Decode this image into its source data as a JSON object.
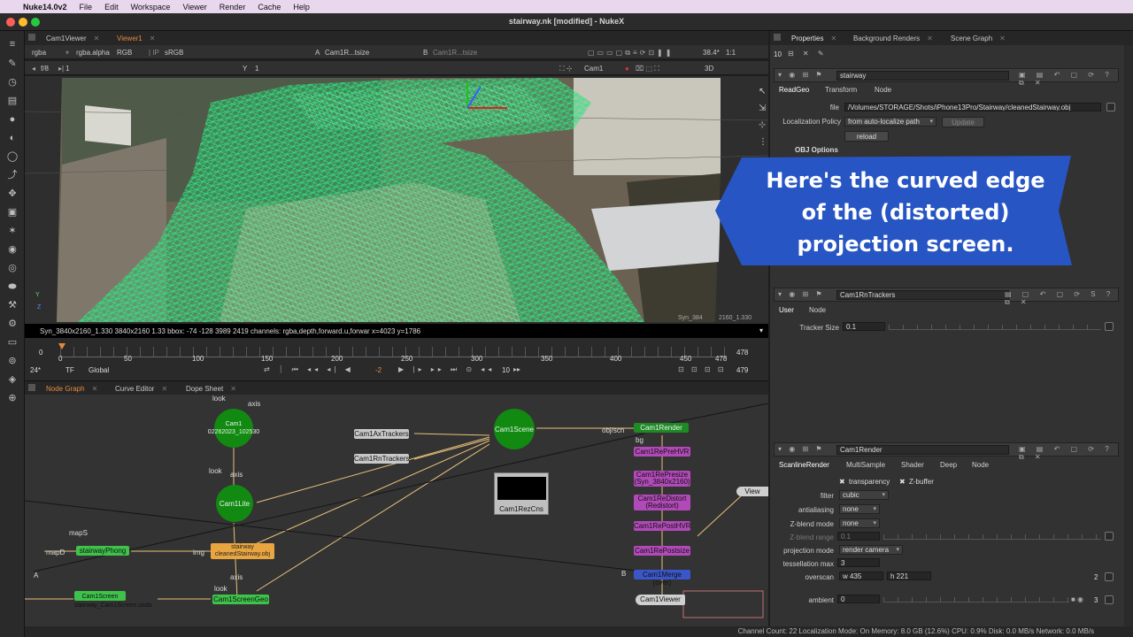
{
  "menubar": {
    "app": "Nuke14.0v2",
    "items": [
      "File",
      "Edit",
      "Workspace",
      "Viewer",
      "Render",
      "Cache",
      "Help"
    ]
  },
  "window": {
    "title": "stairway.nk [modified] - NukeX"
  },
  "viewer": {
    "tabs": [
      "Cam1Viewer",
      "Viewer1"
    ],
    "bar1": {
      "channels": "rgba",
      "alpha": "rgba.alpha",
      "colorspace": "RGB",
      "lut": "sRGB",
      "input_a_label": "A",
      "input_a": "Cam1R...tsize",
      "input_b_label": "B",
      "input_b": "Cam1R...tsize",
      "zoom": "38.4*",
      "ratio": "1:1"
    },
    "bar2": {
      "fstop": "f/8",
      "frame": "1",
      "y_label": "Y",
      "y_value": "1",
      "camera": "Cam1",
      "view_mode": "3D"
    },
    "overlay_corner": "Syn_384",
    "overlay_corner2": "2160_1.330",
    "axis_y": "Y",
    "axis_z": "Z",
    "info": "Syn_3840x2160_1.330 3840x2160 1.33  bbox: -74 -128 3989 2419 channels: rgba,depth,forward.u,forwar  x=4023 y=1786"
  },
  "timeline": {
    "ticks": [
      "0",
      "50",
      "100",
      "150",
      "200",
      "250",
      "300",
      "350",
      "400",
      "450",
      "478"
    ],
    "start": "0",
    "end_top": "478",
    "end_bottom": "479",
    "fps": "24*",
    "tf": "TF",
    "mode": "Global",
    "step_back": "-2",
    "step": "10"
  },
  "nodegraph": {
    "tabs": [
      "Node Graph",
      "Curve Editor",
      "Dope Sheet"
    ],
    "nodes": {
      "cam1": "Cam1\n02262023_102530",
      "cam1lite": "Cam1Lite",
      "cam1scene": "Cam1Scene",
      "cam1axtrackers": "Cam1AxTrackers",
      "cam1rntrackers": "Cam1RnTrackers",
      "cam1rezcns": "Cam1RezCns",
      "stairwayphong": "stairwayPhong",
      "stairway": "stairway\ncleanedStairway.obj",
      "cam1screen": "Cam1Screen\nstairway_Cam1Screen.usda",
      "cam1screengeo": "Cam1ScreenGeo",
      "cam1render": "Cam1Render",
      "cam1reprehvr": "Cam1RePreHVR",
      "cam1represize": "Cam1RePresize\n(Syn_3840x2160)",
      "cam1redistort": "Cam1ReDistort\n(Redistort)",
      "cam1reposthvr": "Cam1RePostHVR",
      "cam1repostsize": "Cam1RePostsize",
      "cam1merge": "Cam1Merge (over)",
      "cam1viewer": "Cam1Viewer",
      "view": "View"
    },
    "labels": {
      "look1": "look",
      "axis1": "axis",
      "look2": "look",
      "axis2": "axis",
      "look3": "look",
      "axis3": "axis",
      "mapS": "mapS",
      "mapD": "mapD",
      "img": "img",
      "obj_scn": "obj/scn",
      "bg": "bg",
      "A": "A",
      "B": "B"
    }
  },
  "statusbar": "Channel Count: 22  Localization Mode: On  Memory: 8.0 GB (12.6%)  CPU: 0.9%  Disk: 0.0 MB/s  Network: 0.0 MB/s",
  "rightpanel": {
    "tabs": [
      "Properties",
      "Background Renders",
      "Scene Graph"
    ],
    "count": "10",
    "readgeo": {
      "name": "stairway",
      "tabs": [
        "ReadGeo",
        "Transform",
        "Node"
      ],
      "file_label": "file",
      "file": "/Volumes/STORAGE/Shots/iPhone13Pro/Stairway/cleanedStairway.obj",
      "policy_label": "Localization Policy",
      "policy": "from auto-localize path",
      "update": "Update",
      "reload": "reload",
      "obj_options": "OBJ Options"
    },
    "callout": "Here's the curved edge of the (distorted) projection screen.",
    "tracker": {
      "name": "Cam1RnTrackers",
      "tabs": [
        "User",
        "Node"
      ],
      "size_label": "Tracker Size",
      "size": "0.1"
    },
    "render": {
      "name": "Cam1Render",
      "tabs": [
        "ScanlineRender",
        "MultiSample",
        "Shader",
        "Deep",
        "Node"
      ],
      "transparency": "transparency",
      "zbuffer": "Z-buffer",
      "filter_label": "filter",
      "filter": "cubic",
      "aa_label": "antialiasing",
      "aa": "none",
      "zblend_label": "Z-blend mode",
      "zblend": "none",
      "zrange_label": "Z-blend range",
      "zrange": "0.1",
      "proj_label": "projection mode",
      "proj": "render camera",
      "tess_label": "tessellation max",
      "tess": "3",
      "overscan_label": "overscan",
      "overscan_w": "w 435",
      "overscan_h": "h 221",
      "overscan_n": "2",
      "ambient_label": "ambient",
      "ambient": "0",
      "ambient_n": "3"
    },
    "slider_ticks_a": [
      "0",
      "0.5",
      "1",
      "1.5",
      "2",
      "2.5",
      "3",
      "3.5",
      "4",
      "4.5"
    ],
    "slider_ticks_b": [
      "0.001",
      "0.01",
      "0.1",
      "0.2",
      "0.4",
      "1"
    ],
    "slider_ticks_c": [
      "0",
      "0.05",
      "0.1",
      "0.2",
      "0.3",
      "0.4",
      "0.5",
      "0.6",
      "0.7",
      "0.8",
      "0.9",
      "1"
    ]
  },
  "colors": {
    "accent": "#e58a3c",
    "node_green": "#128a12",
    "callout_blue": "#2755c4",
    "wire": "#3cf08c"
  }
}
